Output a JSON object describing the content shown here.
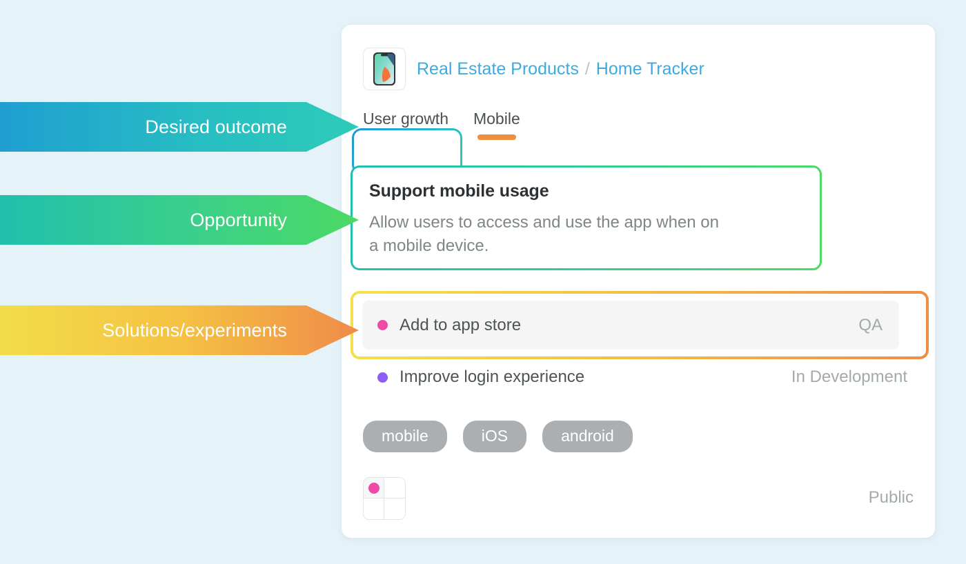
{
  "annotations": [
    {
      "id": "desired-outcome",
      "label": "Desired outcome"
    },
    {
      "id": "opportunity",
      "label": "Opportunity"
    },
    {
      "id": "solutions",
      "label": "Solutions/experiments"
    }
  ],
  "card": {
    "thumbnail_icon": "phone-thumbnail-icon",
    "breadcrumb": {
      "parent": "Real Estate Products",
      "separator": "/",
      "current": "Home Tracker"
    },
    "tabs": [
      {
        "label": "User growth",
        "color": "#9a6ae0",
        "selected": true
      },
      {
        "label": "Mobile",
        "color": "#ee8f3e",
        "selected": false
      }
    ],
    "opportunity": {
      "title": "Support mobile usage",
      "description": "Allow users to access and use the app when on a mobile device."
    },
    "solutions": [
      {
        "name": "Add to app store",
        "status": "QA",
        "dot_color": "#ef4aa8",
        "highlighted": true
      },
      {
        "name": "Improve login experience",
        "status": "In Development",
        "dot_color": "#8b5cf6",
        "highlighted": false
      }
    ],
    "tags": [
      "mobile",
      "iOS",
      "android"
    ],
    "footer": {
      "matrix_icon": "opportunity-matrix-icon",
      "matrix_dot_color": "#ef4aa8",
      "visibility": "Public"
    }
  },
  "colors": {
    "background": "#e5f2f7",
    "card": "#ffffff",
    "link": "#3eaade",
    "outcome_gradient_start": "#1f9fd1",
    "outcome_gradient_end": "#2ecbb8",
    "opportunity_gradient_start": "#21bfae",
    "opportunity_gradient_end": "#4cd964",
    "solutions_gradient_start": "#f2dd4a",
    "solutions_gradient_end": "#ef8b49",
    "tag": "#abafb1",
    "muted_text": "#a3aaad"
  }
}
